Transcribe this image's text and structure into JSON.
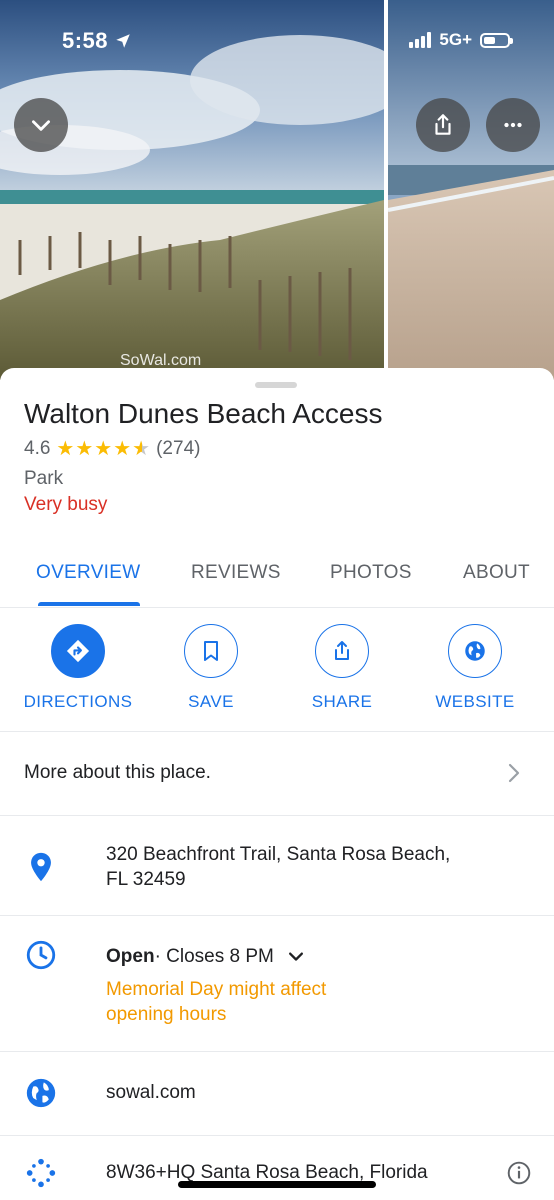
{
  "status_bar": {
    "time": "5:58",
    "network": "5G+"
  },
  "header": {
    "watermark": "SoWal.com"
  },
  "place": {
    "title": "Walton Dunes Beach Access",
    "rating": "4.6",
    "rating_stars": 4.6,
    "review_count": "(274)",
    "category": "Park",
    "busy_status": "Very busy"
  },
  "tabs": [
    "OVERVIEW",
    "REVIEWS",
    "PHOTOS",
    "ABOUT"
  ],
  "actions": {
    "directions": "DIRECTIONS",
    "save": "SAVE",
    "share": "SHARE",
    "website": "WEBSITE"
  },
  "more_about": "More about this place.",
  "address": {
    "line1": "320 Beachfront Trail, Santa Rosa Beach,",
    "line2": "FL 32459"
  },
  "hours": {
    "open": "Open",
    "closes": " · Closes 8 PM",
    "warning_line1": "Memorial Day might affect",
    "warning_line2": "opening hours"
  },
  "website": "sowal.com",
  "plus_code": "8W36+HQ Santa Rosa Beach, Florida",
  "colors": {
    "accent": "#1a73e8",
    "busy": "#d93025",
    "warning": "#f29900",
    "star": "#fbbc04"
  }
}
